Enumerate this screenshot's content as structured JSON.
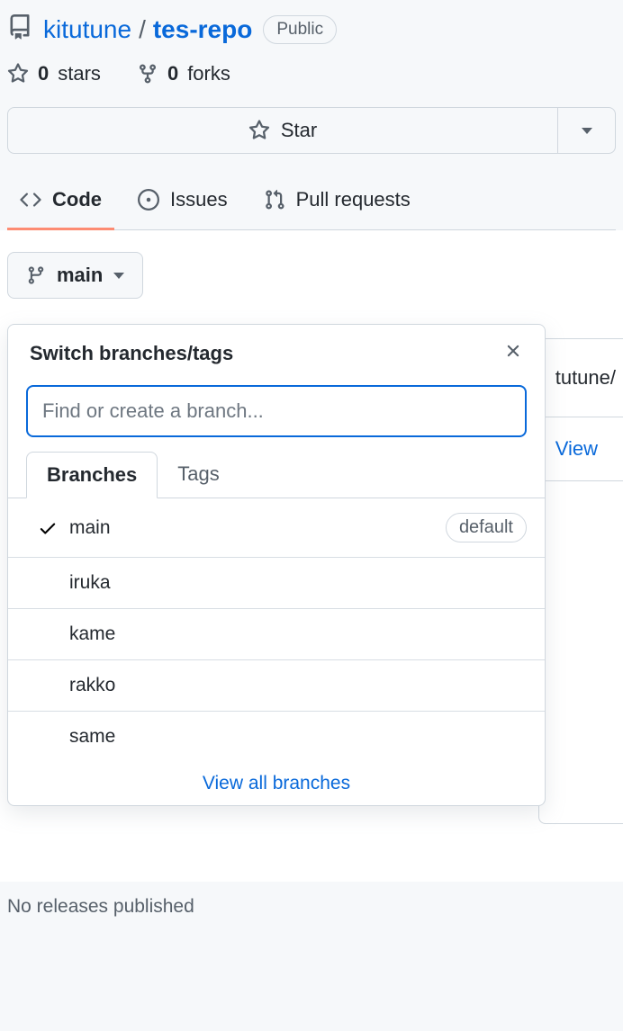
{
  "header": {
    "owner": "kitutune",
    "repo": "tes-repo",
    "visibility": "Public"
  },
  "stats": {
    "stars_count": "0",
    "stars_label": "stars",
    "forks_count": "0",
    "forks_label": "forks"
  },
  "star_button": {
    "label": "Star"
  },
  "tabs": {
    "code": "Code",
    "issues": "Issues",
    "pulls": "Pull requests"
  },
  "branch_button": {
    "current": "main"
  },
  "popover": {
    "title": "Switch branches/tags",
    "search_placeholder": "Find or create a branch...",
    "tab_branches": "Branches",
    "tab_tags": "Tags",
    "branches": [
      {
        "name": "main",
        "selected": true,
        "default": true
      },
      {
        "name": "iruka",
        "selected": false,
        "default": false
      },
      {
        "name": "kame",
        "selected": false,
        "default": false
      },
      {
        "name": "rakko",
        "selected": false,
        "default": false
      },
      {
        "name": "same",
        "selected": false,
        "default": false
      }
    ],
    "default_label": "default",
    "view_all": "View all branches"
  },
  "behind": {
    "row1": "tutune/",
    "row2": "View"
  },
  "releases": {
    "text": "No releases published"
  }
}
